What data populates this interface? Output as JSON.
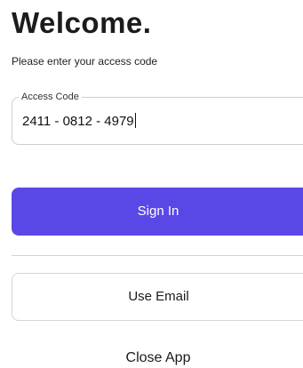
{
  "header": {
    "title": "Welcome.",
    "subtitle": "Please enter your access code"
  },
  "access_code": {
    "label": "Access Code",
    "value": "2411 - 0812 - 4979"
  },
  "actions": {
    "sign_in_label": "Sign In",
    "use_email_label": "Use Email",
    "close_app_label": "Close App"
  },
  "colors": {
    "primary": "#5a48e6",
    "divider": "#c9d3e3",
    "border": "#cfcfcf"
  }
}
